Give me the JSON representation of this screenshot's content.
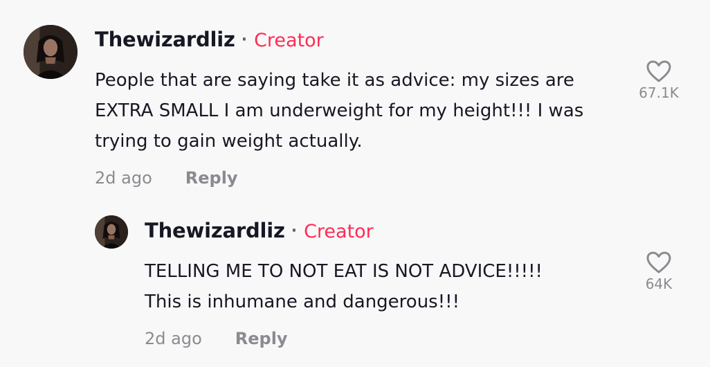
{
  "comment": {
    "username": "Thewizardliz",
    "separator": "·",
    "badge": "Creator",
    "text_lines": [
      "People that are saying take it as advice: my sizes are",
      "EXTRA SMALL I am underweight for my height!!! I was",
      "trying to gain weight actually."
    ],
    "timestamp": "2d ago",
    "reply_label": "Reply",
    "like_icon": "heart-outline-icon",
    "like_count": "67.1K"
  },
  "reply": {
    "username": "Thewizardliz",
    "separator": "·",
    "badge": "Creator",
    "text_lines": [
      "TELLING ME TO NOT EAT IS NOT ADVICE!!!!!",
      "This is inhumane and dangerous!!!"
    ],
    "timestamp": "2d ago",
    "reply_label": "Reply",
    "like_icon": "heart-outline-icon",
    "like_count": "64K"
  },
  "colors": {
    "background": "#f8f8f8",
    "text": "#161823",
    "creator_badge": "#fe2c55",
    "muted": "#8a8b91"
  }
}
